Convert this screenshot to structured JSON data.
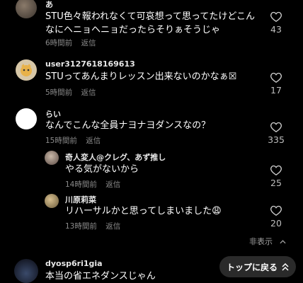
{
  "comments": [
    {
      "username": "あ",
      "text": "STU色々報われなくて可哀想って思ってたけどこんなにヘニョヘニョだったらそりぁそうじゃ",
      "time": "6時間前",
      "reply_label": "返信",
      "likes": "43"
    },
    {
      "username": "user3127618169613",
      "text": "STUってあんまりレッスン出来ないのかなぁ☒",
      "time": "5時間前",
      "reply_label": "返信",
      "likes": "17"
    },
    {
      "username": "らい",
      "text": "なんでこんな全員ナヨナヨダンスなの？",
      "time": "15時間前",
      "reply_label": "返信",
      "likes": "335"
    }
  ],
  "replies": [
    {
      "username": "奇人変人@クレグ、あず推し",
      "text": "やる気がないから",
      "time": "14時間前",
      "reply_label": "返信",
      "likes": "25"
    },
    {
      "username": "川原莉菜",
      "text": "リハーサルかと思ってしまいました😩",
      "time": "13時間前",
      "reply_label": "返信",
      "likes": "20"
    }
  ],
  "hide_replies_label": "非表示",
  "last_comment": {
    "username": "dyosp6ri1gia",
    "text": "本当の省エネダンスじゃん"
  },
  "back_to_top_label": "トップに戻る",
  "colors": {
    "background": "#000000",
    "meta_text": "#8a8a8a",
    "button_bg": "#2a2a2a"
  }
}
